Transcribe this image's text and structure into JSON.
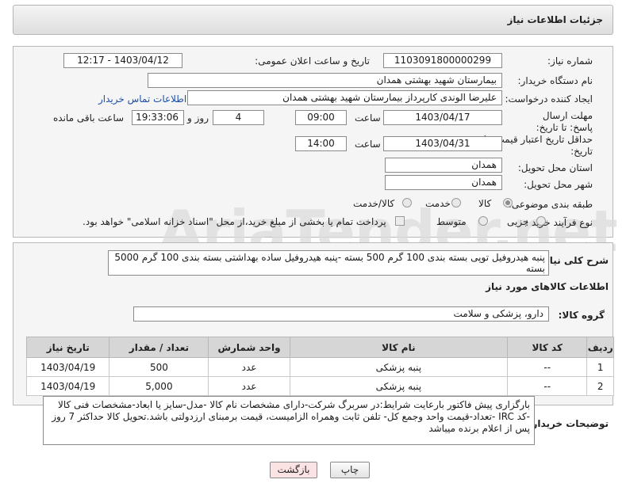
{
  "header": {
    "title": "جزئیات اطلاعات نیاز"
  },
  "form": {
    "need_number_label": "شماره نیاز:",
    "need_number": "1103091800000299",
    "announce_label": "تاریخ و ساعت اعلان عمومی:",
    "announce_value": "1403/04/12 - 12:17",
    "buyer_org_label": "نام دستگاه خریدار:",
    "buyer_org": "بیمارستان شهید بهشتی همدان",
    "creator_label": "ایجاد کننده درخواست:",
    "creator": "علیرضا الوندی کارپرداز بیمارستان شهید بهشتی همدان",
    "contact_link": "اطلاعات تماس خریدار",
    "deadline_label": "مهلت ارسال پاسخ: تا تاریخ:",
    "deadline_date": "1403/04/17",
    "time_label": "ساعت",
    "deadline_time": "09:00",
    "days_value": "4",
    "days_label": "روز و",
    "remaining_time": "19:33:06",
    "remaining_label": "ساعت باقی مانده",
    "validity_label": "حداقل تاریخ اعتبار قیمت: تا تاریخ:",
    "validity_date": "1403/04/31",
    "validity_time_label": "ساعت",
    "validity_time": "14:00",
    "province_label": "استان محل تحویل:",
    "province": "همدان",
    "city_label": "شهر محل تحویل:",
    "city": "همدان",
    "category_label": "طبقه بندی موضوعی:",
    "category_options": [
      "کالا",
      "خدمت",
      "کالا/خدمت"
    ],
    "purchase_label": "نوع فرآیند خرید :",
    "purchase_options": [
      "جزیی",
      "متوسط"
    ],
    "payment_note": "پرداخت تمام یا بخشی از مبلغ خرید،از محل \"اسناد خزانه اسلامی\" خواهد بود."
  },
  "summary": {
    "label": "شرح کلی نیاز:",
    "text": "پنبه هیدروفیل توپی بسته بندی 100 گرم 500 بسته -پنبه هیدروفیل ساده بهداشتی بسته بندی 100 گرم 5000 بسته"
  },
  "goods": {
    "section_title": "اطلاعات کالاهای مورد نیاز",
    "group_label": "گروه کالا:",
    "group_value": "دارو، پزشکی و سلامت",
    "columns": [
      "ردیف",
      "کد کالا",
      "نام کالا",
      "واحد شمارش",
      "تعداد / مقدار",
      "تاریخ نیاز"
    ],
    "rows": [
      [
        "1",
        "--",
        "پنبه پزشکی",
        "عدد",
        "500",
        "1403/04/19"
      ],
      [
        "2",
        "--",
        "پنبه پزشکی",
        "عدد",
        "5,000",
        "1403/04/19"
      ]
    ]
  },
  "buyer_notes": {
    "label": "توضیحات خریدار:",
    "text": "بارگزاری پیش فاکتور بارعایت شرایط:در سربرگ شرکت-دارای مشخصات نام کالا -مدل-سایز یا ابعاد-مشخصات فنی کالا -کد IRC -تعداد-قیمت واحد وجمع کل- تلفن ثابت وهمراه الزامیست، قیمت برمبنای ارزدولتی باشد.تحویل کالا حداکثر 7 روز پس از اعلام برنده میباشد"
  },
  "buttons": {
    "print": "چاپ",
    "back": "بازگشت"
  },
  "watermark": "AriaTender.net",
  "colors": {
    "link": "#1d4fa8",
    "back_button_bg": "#fbe3e3"
  }
}
